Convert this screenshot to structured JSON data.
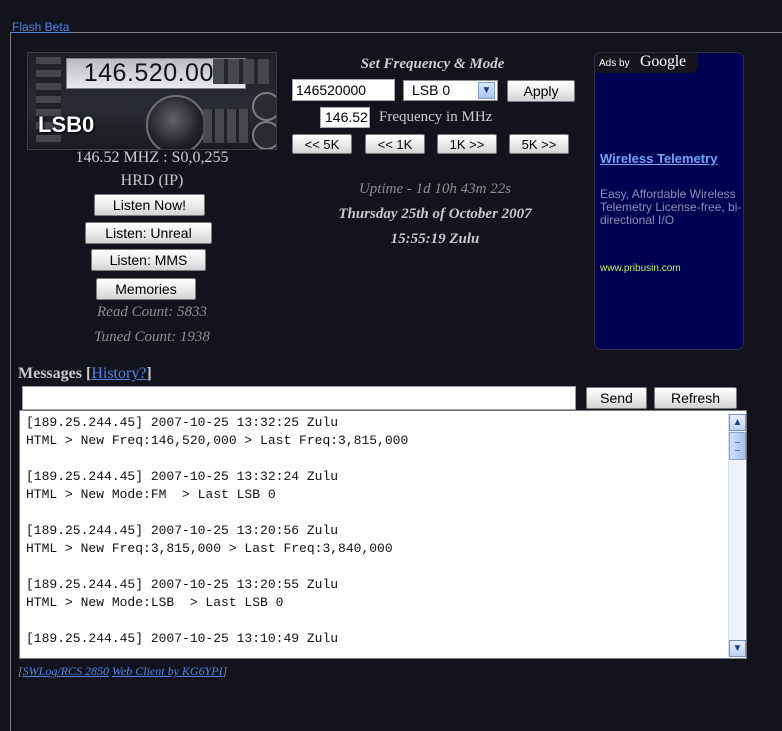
{
  "top_link": "Flash Beta",
  "radio": {
    "frequency_display": "146.520.000",
    "mode_overlay": "LSB0",
    "status_line": "146.52 MHZ : S0,0,255",
    "source": "HRD (IP)"
  },
  "buttons": {
    "listen_now": "Listen Now!",
    "listen_unreal": "Listen: Unreal",
    "listen_mms": "Listen: MMS",
    "memories": "Memories"
  },
  "counts": {
    "read": "Read Count: 5833",
    "tuned": "Tuned Count: 1938"
  },
  "set_frequency": {
    "title": "Set Frequency & Mode",
    "frequency_value": "146520000",
    "mode_selected": "LSB 0",
    "apply_label": "Apply",
    "mhz_value": "146.52",
    "mhz_label": "Frequency in MHz",
    "step_buttons": [
      "<< 5K",
      "<< 1K",
      "1K >>",
      "5K >>"
    ]
  },
  "status": {
    "uptime": "Uptime - 1d 10h 43m 22s",
    "date": "Thursday 25th of October 2007",
    "time": "15:55:19 Zulu"
  },
  "ad": {
    "label": "Ads by",
    "brand": "Google",
    "title": "Wireless Telemetry",
    "text": "Easy, Affordable Wireless Telemetry License-free, bi-directional I/O",
    "url": "www.pribusin.com"
  },
  "messages": {
    "label": "Messages",
    "history_link": "History?",
    "input_value": "",
    "send_label": "Send",
    "refresh_label": "Refresh",
    "log_text": "[189.25.244.45] 2007-10-25 13:32:25 Zulu\nHTML > New Freq:146,520,000 > Last Freq:3,815,000\n\n[189.25.244.45] 2007-10-25 13:32:24 Zulu\nHTML > New Mode:FM  > Last LSB 0\n\n[189.25.244.45] 2007-10-25 13:20:56 Zulu\nHTML > New Freq:3,815,000 > Last Freq:3,840,000\n\n[189.25.244.45] 2007-10-25 13:20:55 Zulu\nHTML > New Mode:LSB  > Last LSB 0\n\n[189.25.244.45] 2007-10-25 13:10:49 Zulu"
  },
  "footer": {
    "link1": "SWLog/RCS 2850",
    "link2": "Web Client by KG6YPI"
  },
  "colors": {
    "background": "#12131c",
    "link": "#4f86e8",
    "ad_background": "#000052",
    "ad_url": "#c2ef4a"
  }
}
